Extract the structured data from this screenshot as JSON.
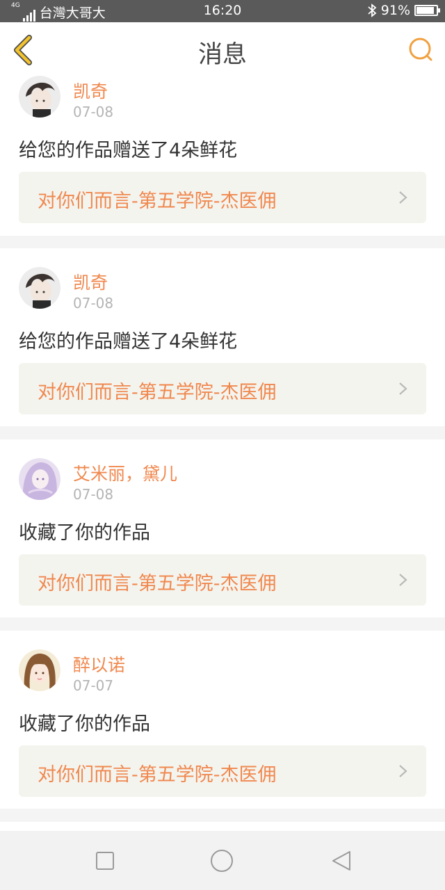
{
  "status_bar": {
    "network": "4G",
    "carrier": "台灣大哥大",
    "time": "16:20",
    "bluetooth_icon": "bluetooth-icon",
    "battery_text": "91%",
    "battery_level": 0.91
  },
  "header": {
    "title": "消息",
    "back_icon": "chevron-left-icon",
    "search_icon": "search-icon",
    "accent_color": "#f0a040"
  },
  "messages": [
    {
      "user": "凯奇",
      "date": "07-08",
      "action": "给您的作品赠送了4朵鲜花",
      "work": "对你们而言-第五学院-杰医佣",
      "avatar": "avatar-boy-dark-hair"
    },
    {
      "user": "凯奇",
      "date": "07-08",
      "action": "给您的作品赠送了4朵鲜花",
      "work": "对你们而言-第五学院-杰医佣",
      "avatar": "avatar-boy-dark-hair"
    },
    {
      "user": "艾米丽，黛儿",
      "date": "07-08",
      "action": "收藏了你的作品",
      "work": "对你们而言-第五学院-杰医佣",
      "avatar": "avatar-girl-lavender"
    },
    {
      "user": "醉以诺",
      "date": "07-07",
      "action": "收藏了你的作品",
      "work": "对你们而言-第五学院-杰医佣",
      "avatar": "avatar-girl-brown-hair"
    }
  ],
  "nav_bar": {
    "recents_icon": "square-icon",
    "home_icon": "circle-icon",
    "back_icon": "triangle-back-icon"
  },
  "colors": {
    "accent_orange": "#f0884e",
    "link_bg": "#f4f4ef",
    "separator": "#f4f4f4"
  }
}
